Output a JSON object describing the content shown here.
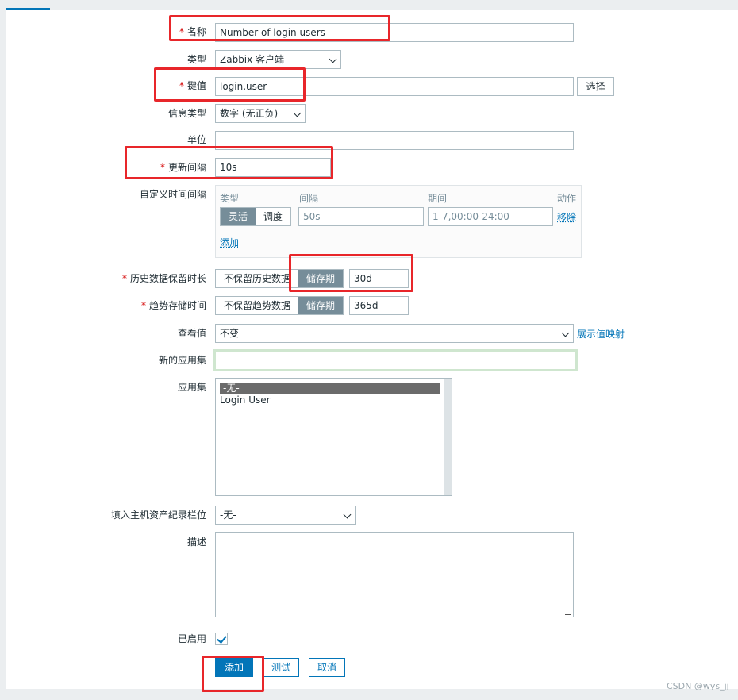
{
  "form": {
    "name": {
      "label": "名称",
      "required": true,
      "value": "Number of login users"
    },
    "type": {
      "label": "类型",
      "value": "Zabbix 客户端"
    },
    "key": {
      "label": "键值",
      "required": true,
      "value": "login.user",
      "select_button": "选择"
    },
    "info_type": {
      "label": "信息类型",
      "value": "数字 (无正负)"
    },
    "units": {
      "label": "单位",
      "value": ""
    },
    "update_interval": {
      "label": "更新间隔",
      "required": true,
      "value": "10s"
    },
    "custom_intervals": {
      "label": "自定义时间间隔",
      "headers": {
        "type": "类型",
        "interval": "间隔",
        "period": "期间",
        "action": "动作"
      },
      "row": {
        "flexible": "灵活",
        "scheduling": "调度",
        "interval_placeholder": "50s",
        "period_placeholder": "1-7,00:00-24:00",
        "remove": "移除"
      },
      "add": "添加"
    },
    "history": {
      "label": "历史数据保留时长",
      "required": true,
      "opt_no_keep": "不保留历史数据",
      "opt_keep": "储存期",
      "value": "30d"
    },
    "trends": {
      "label": "趋势存储时间",
      "required": true,
      "opt_no_keep": "不保留趋势数据",
      "opt_keep": "储存期",
      "value": "365d"
    },
    "show_value": {
      "label": "查看值",
      "value": "不变",
      "link": "展示值映射"
    },
    "new_app": {
      "label": "新的应用集",
      "value": ""
    },
    "applications": {
      "label": "应用集",
      "options": [
        "-无-",
        "Login User"
      ],
      "selected_index": 0
    },
    "inventory": {
      "label": "填入主机资产纪录栏位",
      "value": "-无-"
    },
    "description": {
      "label": "描述",
      "value": ""
    },
    "enabled": {
      "label": "已启用",
      "checked": true
    }
  },
  "buttons": {
    "add": "添加",
    "test": "测试",
    "cancel": "取消"
  },
  "watermark": "CSDN @wys_jj",
  "colors": {
    "accent": "#0275b8",
    "annotation": "#e8262a",
    "required": "#d40000"
  }
}
